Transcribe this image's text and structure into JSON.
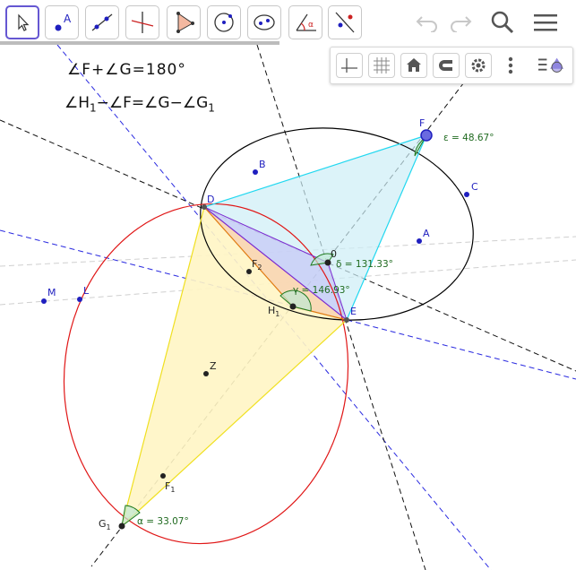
{
  "toolbar": {
    "tools": [
      {
        "name": "move-tool",
        "label": ""
      },
      {
        "name": "point-tool",
        "label": "A"
      },
      {
        "name": "line-tool",
        "label": ""
      },
      {
        "name": "perpendicular-tool",
        "label": ""
      },
      {
        "name": "polygon-tool",
        "label": ""
      },
      {
        "name": "circle-tool",
        "label": ""
      },
      {
        "name": "ellipse-tool",
        "label": ""
      },
      {
        "name": "angle-tool",
        "label": "α"
      },
      {
        "name": "reflect-tool",
        "label": ""
      }
    ],
    "icons": [
      "undo-icon",
      "redo-icon",
      "search-icon",
      "menu-icon"
    ]
  },
  "stylebar": {
    "icons": [
      "axes-icon",
      "grid-icon",
      "home-icon",
      "magnet-icon",
      "settings-icon",
      "more-icon",
      "algebra-toggle-icon"
    ]
  },
  "equations": {
    "eq1": "∠F+∠G=180°",
    "eq2_a": "∠H",
    "eq2_sub1": "1",
    "eq2_b": "−∠F=∠G−∠G",
    "eq2_sub2": "1"
  },
  "points": {
    "F": "F",
    "B": "B",
    "C": "C",
    "D": "D",
    "A": "A",
    "O": "0",
    "F2": "F",
    "F2_sub": "2",
    "M": "M",
    "L": "L",
    "H1": "H",
    "H1_sub": "1",
    "E": "E",
    "Z": "Z",
    "F1": "F",
    "F1_sub": "1",
    "G1": "G",
    "G1_sub": "1"
  },
  "angles": {
    "epsilon": "ε = 48.67°",
    "delta": "δ = 131.33°",
    "gamma": "γ = 146.93°",
    "alpha": "α = 33.07°"
  },
  "colors": {
    "accent": "#6557d2",
    "point": "#1f1fbf",
    "black_ellipse": "#000000",
    "red_ellipse": "#e01616",
    "blue_dashed": "#2a2ae0",
    "cyan": "#22d8f0",
    "angle_green": "#1f7a1f",
    "yellow": "#ffe84a",
    "orange": "#e07a10",
    "purple": "#7a2ad0"
  }
}
